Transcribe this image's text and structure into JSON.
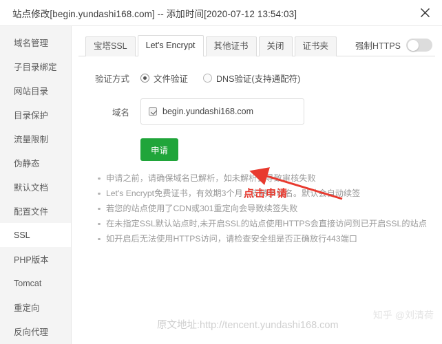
{
  "window": {
    "title": "站点修改[begin.yundashi168.com] -- 添加时间[2020-07-12 13:54:03]",
    "close_icon": "close-icon"
  },
  "sidebar": {
    "items": [
      {
        "label": "域名管理",
        "active": false
      },
      {
        "label": "子目录绑定",
        "active": false
      },
      {
        "label": "网站目录",
        "active": false
      },
      {
        "label": "目录保护",
        "active": false
      },
      {
        "label": "流量限制",
        "active": false
      },
      {
        "label": "伪静态",
        "active": false
      },
      {
        "label": "默认文档",
        "active": false
      },
      {
        "label": "配置文件",
        "active": false
      },
      {
        "label": "SSL",
        "active": true
      },
      {
        "label": "PHP版本",
        "active": false
      },
      {
        "label": "Tomcat",
        "active": false
      },
      {
        "label": "重定向",
        "active": false
      },
      {
        "label": "反向代理",
        "active": false
      }
    ]
  },
  "tabs": [
    {
      "label": "宝塔SSL",
      "active": false
    },
    {
      "label": "Let's Encrypt",
      "active": true
    },
    {
      "label": "其他证书",
      "active": false
    },
    {
      "label": "关闭",
      "active": false
    },
    {
      "label": "证书夹",
      "active": false
    }
  ],
  "force_https": {
    "label": "强制HTTPS",
    "enabled": false
  },
  "form": {
    "verify_label": "验证方式",
    "verify_options": [
      {
        "label": "文件验证",
        "selected": true
      },
      {
        "label": "DNS验证(支持通配符)",
        "selected": false
      }
    ],
    "domain_label": "域名",
    "domain_value": "begin.yundashi168.com",
    "domain_checked": true,
    "apply_label": "申请"
  },
  "annotation": {
    "text": "点击申请",
    "color": "#e8392e"
  },
  "notes": [
    "申请之前，请确保域名已解析，如未解析会导致审核失败",
    "Let's Encrypt免费证书，有效期3个月，支持多域名。默认会自动续签",
    "若您的站点使用了CDN或301重定向会导致续签失败",
    "在未指定SSL默认站点时,未开启SSL的站点使用HTTPS会直接访问到已开启SSL的站点",
    "如开启后无法使用HTTPS访问，请检查安全组是否正确放行443端口"
  ],
  "watermark": {
    "url": "原文地址:http://tencent.yundashi168.com",
    "zhihu": "知乎 @刘清荷"
  },
  "colors": {
    "apply_green": "#20a53a",
    "annotation_red": "#e8392e",
    "sidebar_bg": "#f4f4f4"
  }
}
